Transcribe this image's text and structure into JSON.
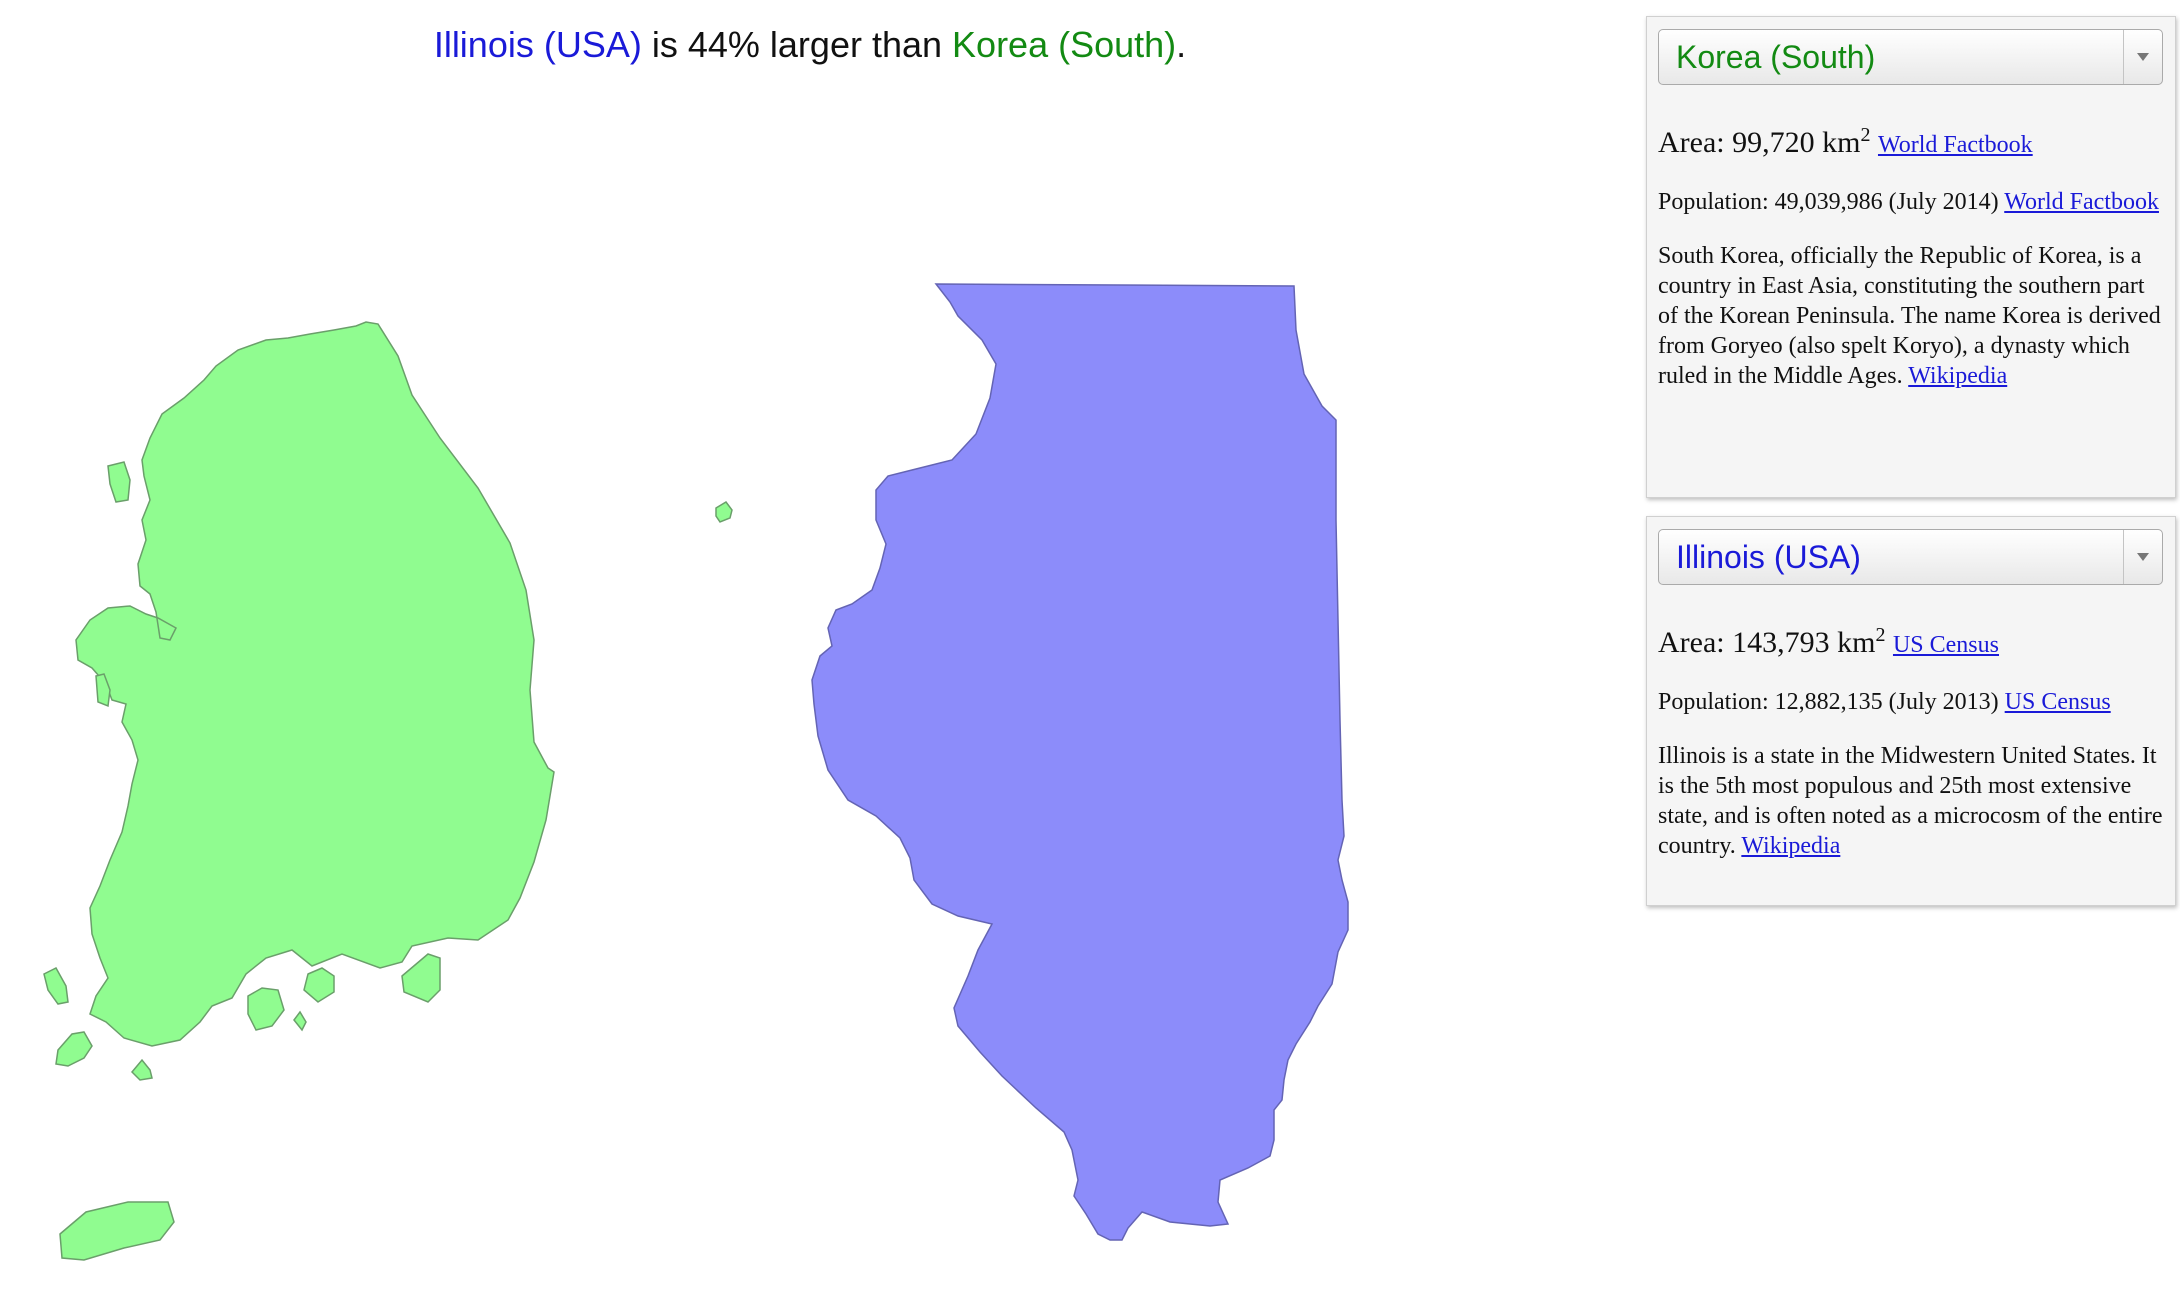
{
  "headline": {
    "region_a": "Illinois (USA)",
    "middle": " is 44% larger than ",
    "region_b": "Korea (South)",
    "end": "."
  },
  "colors": {
    "region_a": "#1a1ad8",
    "region_b": "#138a13",
    "korea_fill": "#90fc90",
    "illinois_fill": "#8c8cfa"
  },
  "panels": [
    {
      "selected": "Korea (South)",
      "area_label": "Area: ",
      "area_value": "99,720 km",
      "area_sup": "2",
      "area_source": "World Factbook",
      "population_label": "Population: ",
      "population_value": "49,039,986 (July 2014)",
      "population_source": "World Factbook",
      "description": "South Korea, officially the Republic of Korea, is a country in East Asia, constituting the southern part of the Korean Peninsula. The name Korea is derived from Goryeo (also spelt Koryo), a dynasty which ruled in the Middle Ages.",
      "description_source": "Wikipedia"
    },
    {
      "selected": "Illinois (USA)",
      "area_label": "Area: ",
      "area_value": "143,793 km",
      "area_sup": "2",
      "area_source": "US Census",
      "population_label": "Population: ",
      "population_value": "12,882,135 (July 2013)",
      "population_source": "US Census",
      "description": "Illinois is a state in the Midwestern United States. It is the 5th most populous and 25th most extensive state, and is often noted as a microcosm of the entire country.",
      "description_source": "Wikipedia"
    }
  ]
}
